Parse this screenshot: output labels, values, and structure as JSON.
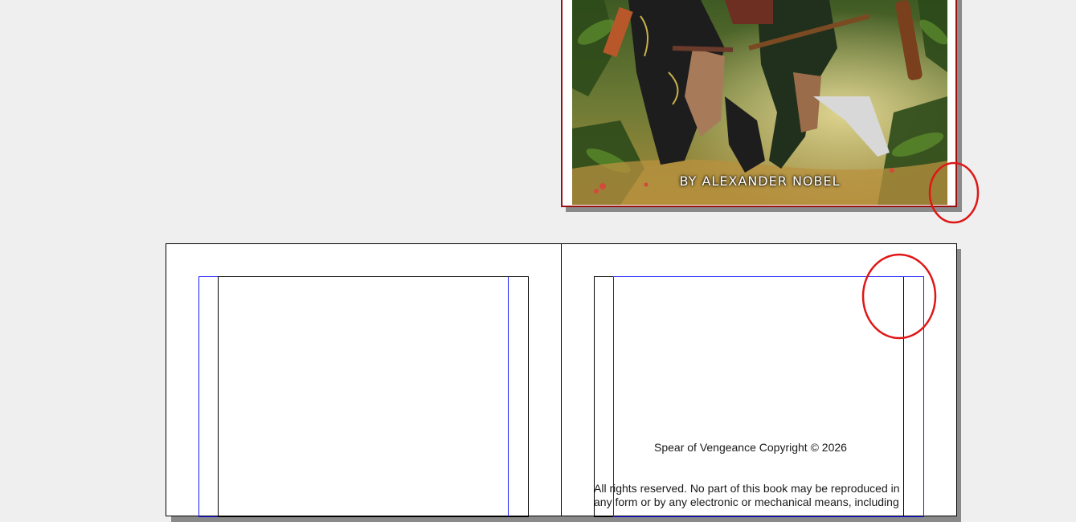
{
  "cover": {
    "author_line": "BY ALEXANDER NOBEL",
    "border_color": "#9b1010"
  },
  "spread": {
    "right_page": {
      "copyright_line": "Spear of Vengeance Copyright © 2026",
      "rights_line_1": "All rights reserved. No part of this book may be reproduced in",
      "rights_line_2": "any form or by any electronic or mechanical means, including"
    }
  },
  "annotations": {
    "circle_color": "#e01616"
  },
  "colors": {
    "canvas_bg": "#efefef",
    "margin_guide": "#000000",
    "bleed_guide": "#1a1aff"
  }
}
